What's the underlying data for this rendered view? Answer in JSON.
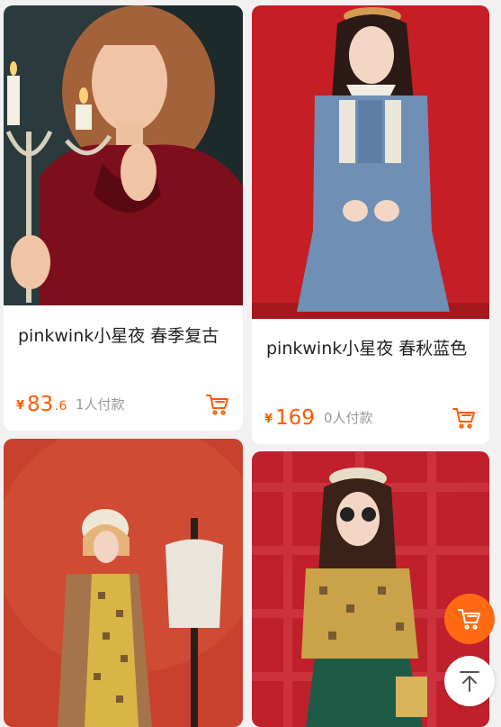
{
  "products": [
    {
      "title": "pinkwink小星夜 春季复古",
      "currency": "¥",
      "price_int": "83",
      "price_dec": ".6",
      "sales": "1人付款",
      "cart_icon": "cart-icon"
    },
    {
      "title": "pinkwink小星夜 春秋蓝色",
      "currency": "¥",
      "price_int": "169",
      "price_dec": "",
      "sales": "0人付款",
      "cart_icon": "cart-icon"
    },
    {
      "title": "",
      "currency": "",
      "price_int": "",
      "price_dec": "",
      "sales": ""
    },
    {
      "title": "",
      "currency": "",
      "price_int": "",
      "price_dec": "",
      "sales": ""
    }
  ],
  "floating": {
    "cart_icon": "cart-icon",
    "back_to_top_icon": "arrow-up-icon"
  },
  "colors": {
    "accent": "#ff5a00",
    "fab_cart_bg": "#ff6a13",
    "page_bg": "#f1f1f1"
  }
}
